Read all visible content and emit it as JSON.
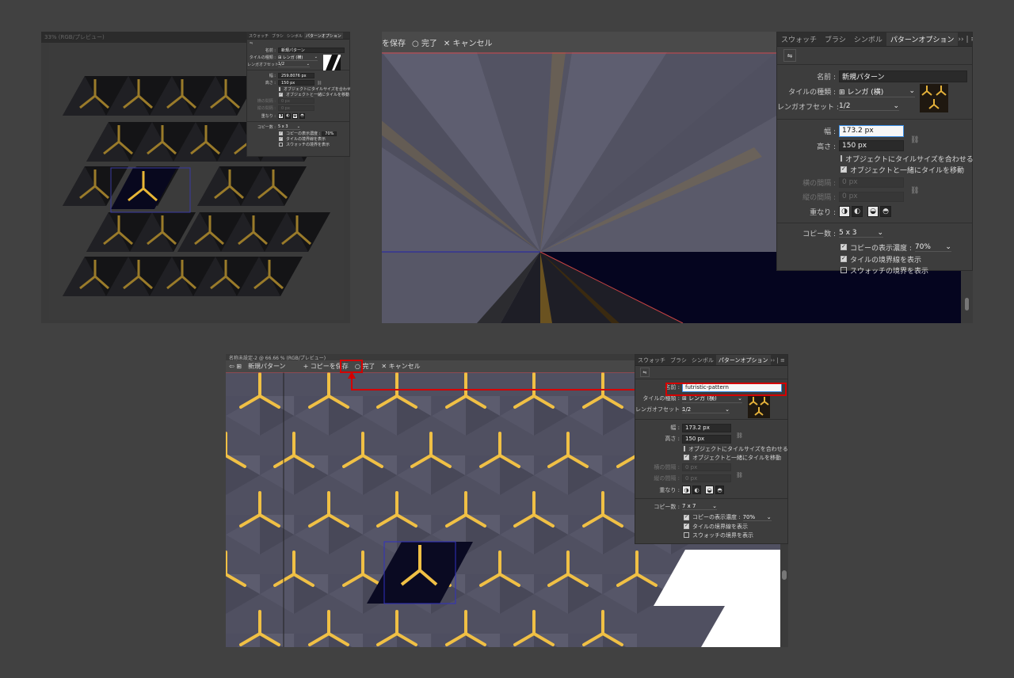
{
  "panel_tabs": [
    "スウォッチ",
    "ブラシ",
    "シンボル",
    "パターンオプション"
  ],
  "panel_menu": "›› | ≡",
  "labels": {
    "name": "名前 :",
    "tile_type": "タイルの種類 :",
    "brick_offset": "レンガオフセット :",
    "width": "幅 :",
    "height": "高さ :",
    "h_spacing": "横の間隔 :",
    "v_spacing": "縦の間隔 :",
    "overlap": "重なり :",
    "copies": "コピー数 :",
    "fit_tile": "オブジェクトにタイルサイズを合わせる",
    "move_tile": "オブジェクトと一緒にタイルを移動",
    "dim_copies": "コピーの表示濃度 :",
    "show_tile_edge": "タイルの境界線を表示",
    "show_swatch_bounds": "スウォッチの境界を表示"
  },
  "shot1": {
    "header": "33% (RGB/プレビュー)",
    "name_value": "新規パターン",
    "tile_type_value": "⊞ レンガ (横)",
    "brick_offset_value": "1/2",
    "width_value": "259.8076 px",
    "height_value": "150 px",
    "h_spacing_value": "0 px",
    "v_spacing_value": "0 px",
    "copies_value": "5 x 3",
    "dim_value": "70%"
  },
  "shot2": {
    "toolbar_save": "を保存",
    "toolbar_done": "○ 完了",
    "toolbar_cancel": "✕ キャンセル",
    "name_value": "新規パターン",
    "tile_type_value": "⊞ レンガ (横)",
    "brick_offset_value": "1/2",
    "width_value": "173.2 px",
    "height_value": "150 px",
    "h_spacing_value": "0 px",
    "v_spacing_value": "0 px",
    "copies_value": "5 x 3",
    "dim_value": "70%"
  },
  "shot3": {
    "header": "名称未設定-2 @ 66.66 % (RGB/プレビュー)",
    "toolbar_pattern": "新規パターン",
    "toolbar_save": "+ コピーを保存",
    "toolbar_done": "○ 完了",
    "toolbar_cancel": "✕ キャンセル",
    "name_value": "futristic-pattern",
    "tile_type_value": "⊞ レンガ (横)",
    "brick_offset_value": "1/2",
    "width_value": "173.2 px",
    "height_value": "150 px",
    "h_spacing_value": "0 px",
    "v_spacing_value": "0 px",
    "copies_value": "7 x 7",
    "dim_value": "70%"
  },
  "colors": {
    "accent_red": "#d40000",
    "gold": "#e6b23a",
    "pattern_bg": "#555566",
    "navy": "#06062a"
  }
}
